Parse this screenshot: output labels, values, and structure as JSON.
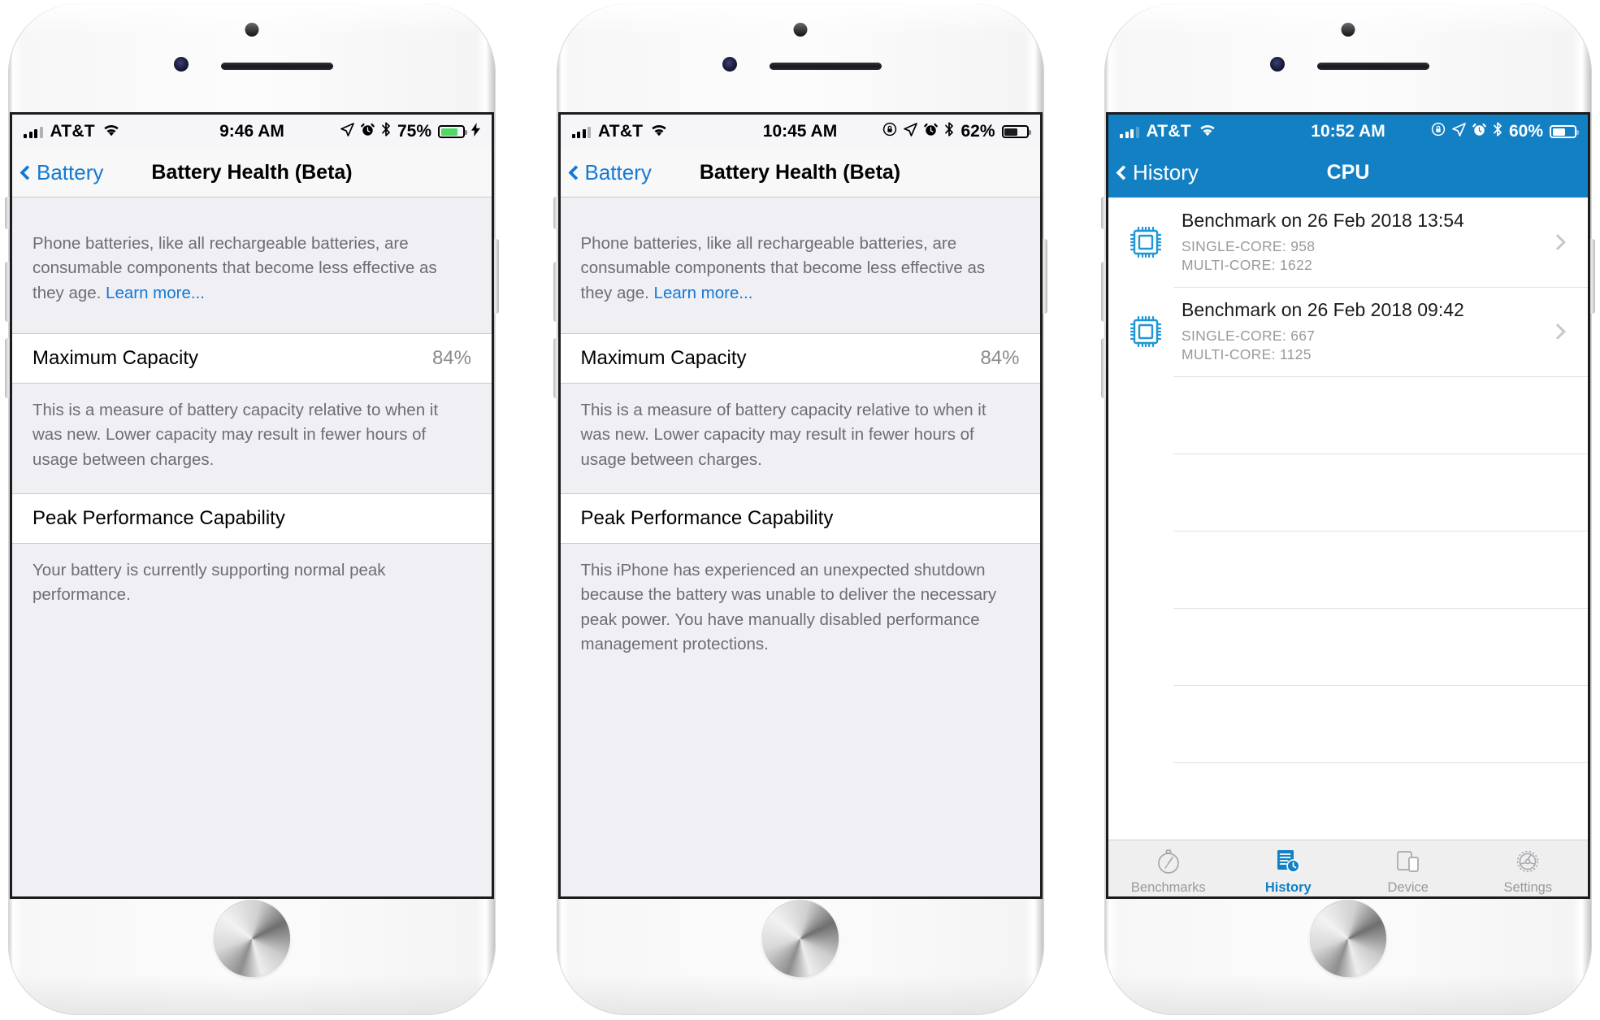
{
  "phones": [
    {
      "id": "phone-left",
      "status": {
        "carrier": "AT&T",
        "time": "9:46 AM",
        "battery_percent": "75%",
        "icons": [
          "signal-bars-icon",
          "wifi-icon",
          "location-arrow-icon",
          "alarm-clock-icon",
          "bluetooth-icon",
          "battery-icon",
          "charging-bolt-icon"
        ],
        "battery_fill_color": "#4cd964",
        "bar_style": "light"
      },
      "nav": {
        "back_label": "Battery",
        "title": "Battery Health (Beta)"
      },
      "intro": {
        "text": "Phone batteries, like all rechargeable batteries, are consumable components that become less effective as they age. ",
        "link": "Learn more..."
      },
      "max_capacity": {
        "label": "Maximum Capacity",
        "value": "84%"
      },
      "max_capacity_note": "This is a measure of battery capacity relative to when it was new. Lower capacity may result in fewer hours of usage between charges.",
      "peak": {
        "label": "Peak Performance Capability"
      },
      "peak_note": "Your battery is currently supporting normal peak performance."
    },
    {
      "id": "phone-middle",
      "status": {
        "carrier": "AT&T",
        "time": "10:45 AM",
        "battery_percent": "62%",
        "icons": [
          "signal-bars-icon",
          "wifi-icon",
          "rotation-lock-icon",
          "location-arrow-icon",
          "alarm-clock-icon",
          "bluetooth-icon",
          "battery-icon"
        ],
        "battery_fill_color": "#1c1c1e",
        "bar_style": "light"
      },
      "nav": {
        "back_label": "Battery",
        "title": "Battery Health (Beta)"
      },
      "intro": {
        "text": "Phone batteries, like all rechargeable batteries, are consumable components that become less effective as they age. ",
        "link": "Learn more..."
      },
      "max_capacity": {
        "label": "Maximum Capacity",
        "value": "84%"
      },
      "max_capacity_note": "This is a measure of battery capacity relative to when it was new. Lower capacity may result in fewer hours of usage between charges.",
      "peak": {
        "label": "Peak Performance Capability"
      },
      "peak_note": "This iPhone has experienced an unexpected shutdown because the battery was unable to deliver the necessary peak power. You have manually disabled performance management protections."
    },
    {
      "id": "phone-right",
      "status": {
        "carrier": "AT&T",
        "time": "10:52 AM",
        "battery_percent": "60%",
        "icons": [
          "signal-bars-icon",
          "wifi-icon",
          "rotation-lock-icon",
          "location-arrow-icon",
          "alarm-clock-icon",
          "bluetooth-icon",
          "battery-icon"
        ],
        "battery_fill_color": "#ffffff",
        "bar_style": "blue"
      },
      "nav": {
        "back_label": "History",
        "title": "CPU"
      },
      "benchmarks": [
        {
          "title": "Benchmark on 26 Feb 2018 13:54",
          "single_core": "SINGLE-CORE: 958",
          "multi_core": "MULTI-CORE: 1622"
        },
        {
          "title": "Benchmark on 26 Feb 2018 09:42",
          "single_core": "SINGLE-CORE: 667",
          "multi_core": "MULTI-CORE: 1125"
        }
      ],
      "empty_rows": 6,
      "tabs": [
        {
          "label": "Benchmarks",
          "icon": "stopwatch-icon",
          "active": false
        },
        {
          "label": "History",
          "icon": "history-document-clock-icon",
          "active": true
        },
        {
          "label": "Device",
          "icon": "devices-icon",
          "active": false
        },
        {
          "label": "Settings",
          "icon": "gear-icon",
          "active": false
        }
      ]
    }
  ],
  "colors": {
    "ios_blue": "#1479d4",
    "app_blue": "#1380c4",
    "group_bg": "#efeff4",
    "secondary_text": "#6d6d72",
    "battery_green": "#4cd964"
  }
}
